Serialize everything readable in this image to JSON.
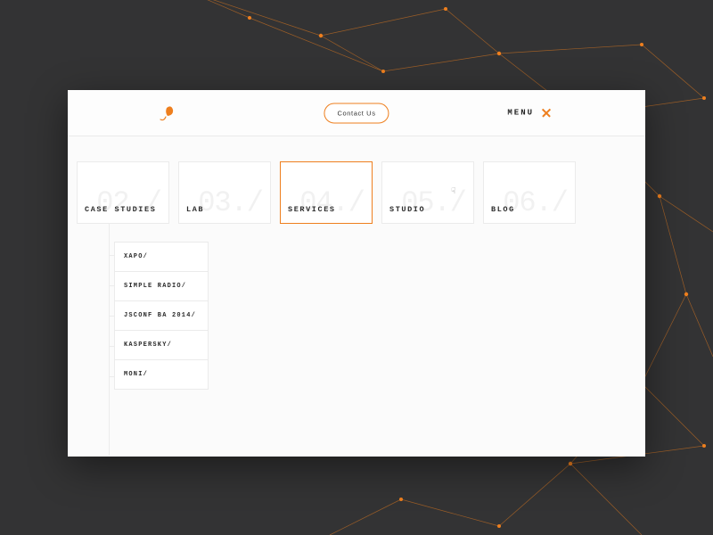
{
  "header": {
    "contact_label": "Contact Us",
    "menu_label": "MENU"
  },
  "colors": {
    "accent": "#ee7f1e",
    "bg_dark": "#333334",
    "card_border": "#ebebeb"
  },
  "nav": {
    "cards": [
      {
        "num": "./",
        "label": ""
      },
      {
        "num": "02./",
        "label": "CASE STUDIES"
      },
      {
        "num": "03./",
        "label": "LAB"
      },
      {
        "num": "04./",
        "label": "SERVICES"
      },
      {
        "num": "05./",
        "label": "STUDIO"
      },
      {
        "num": "06./",
        "label": "BLOG"
      }
    ],
    "active_index": 3
  },
  "submenu": {
    "items": [
      {
        "label": "XAPO/"
      },
      {
        "label": "SIMPLE RADIO/"
      },
      {
        "label": "JSCONF BA 2014/"
      },
      {
        "label": "KASPERSKY/"
      },
      {
        "label": "MONI/"
      }
    ]
  }
}
